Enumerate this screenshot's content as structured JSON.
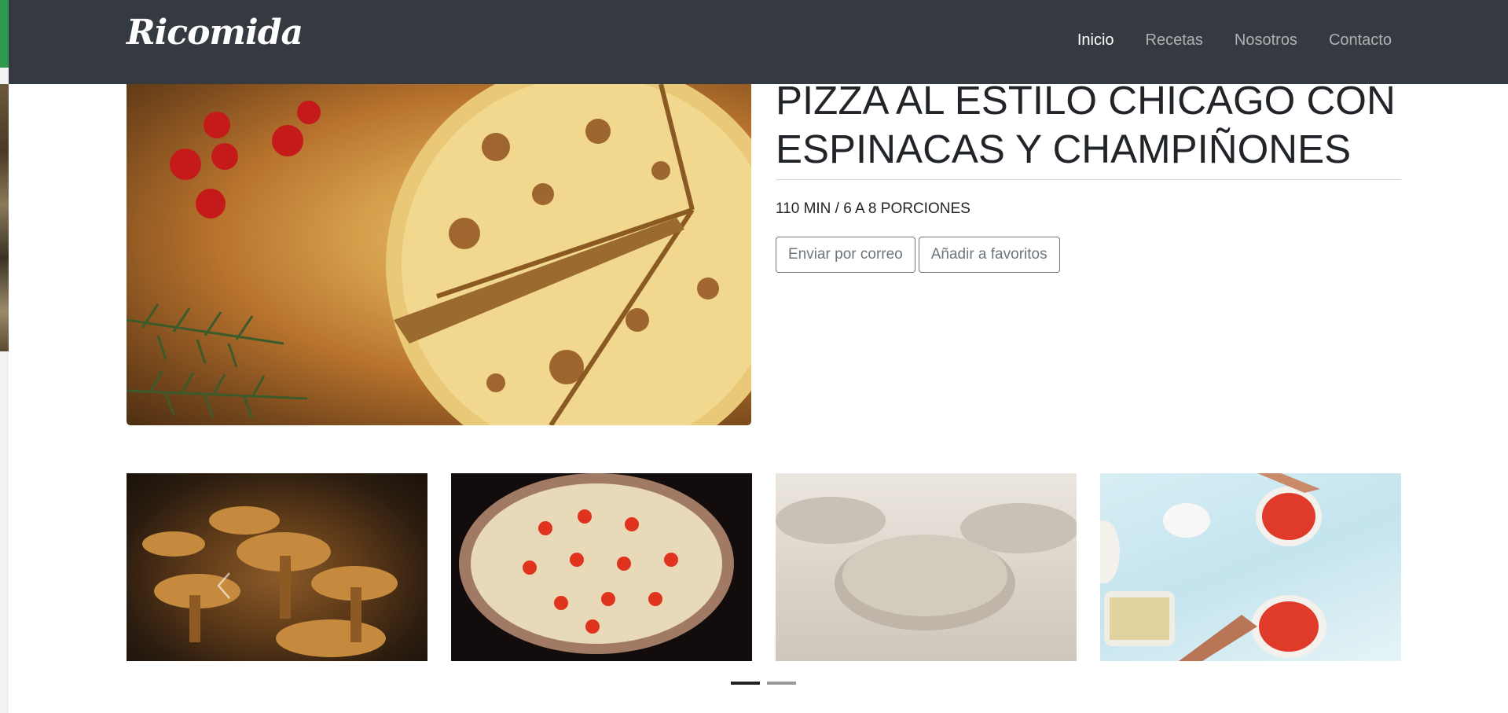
{
  "brand": "Ricomida",
  "nav": [
    {
      "label": "Inicio",
      "active": true
    },
    {
      "label": "Recetas",
      "active": false
    },
    {
      "label": "Nosotros",
      "active": false
    },
    {
      "label": "Contacto",
      "active": false
    }
  ],
  "recipe": {
    "title": "PIZZA AL ESTILO CHICAGO CON ESPINACAS Y CHAMPIÑONES",
    "meta": "110 MIN / 6 A 8 PORCIONES",
    "email_button": "Enviar por correo",
    "favorite_button": "Añadir a favoritos"
  },
  "thumbnails": [
    {
      "alt": "mushrooms"
    },
    {
      "alt": "pizza-in-oven"
    },
    {
      "alt": "dough"
    },
    {
      "alt": "pizza-preparation"
    }
  ],
  "carousel": {
    "prev_icon": "chevron-left-icon",
    "active_slide": 1,
    "slide_count": 2
  },
  "colors": {
    "navbar": "#343a40",
    "accent_green": "#2e9a4f",
    "button_border": "#6c757d"
  }
}
